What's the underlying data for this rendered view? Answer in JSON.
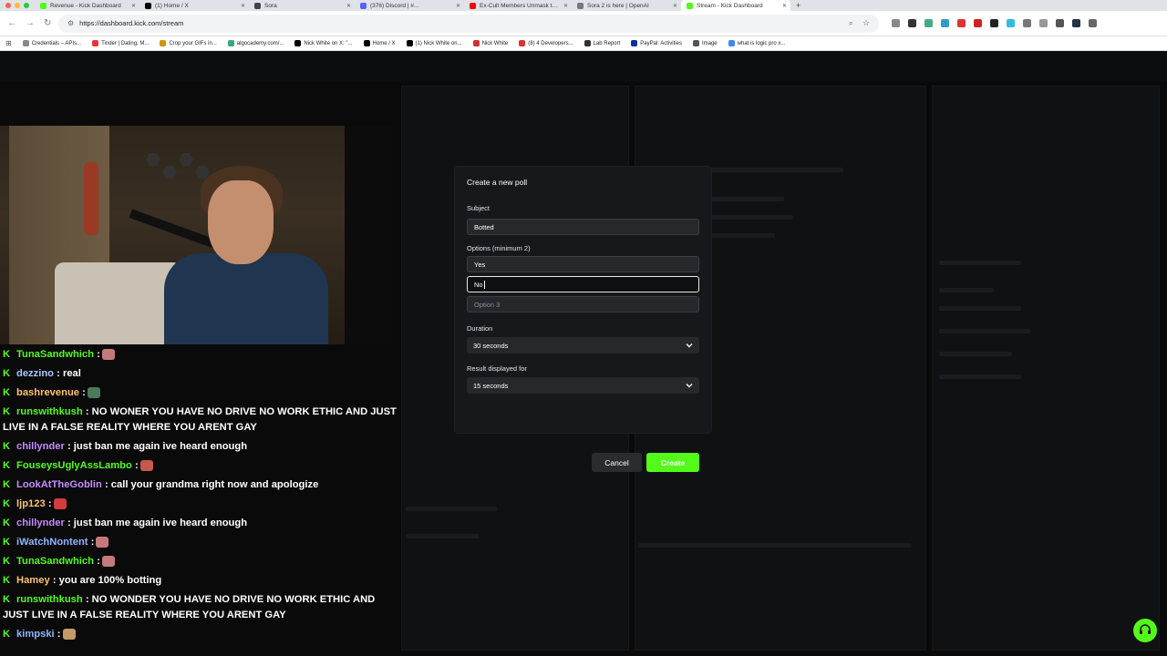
{
  "browser": {
    "tabs": [
      {
        "title": "Revenue - Kick Dashboard",
        "color": "#53fc18"
      },
      {
        "title": "(1) Home / X",
        "color": "#000000"
      },
      {
        "title": "Sora",
        "color": "#444444"
      },
      {
        "title": "(376) Discord | #...",
        "color": "#5865f2"
      },
      {
        "title": "Ex-Cult Members Unmask th...",
        "color": "#ff0000"
      },
      {
        "title": "Sora 2 is here | OpenAI",
        "color": "#777777"
      },
      {
        "title": "Stream - Kick Dashboard",
        "color": "#53fc18",
        "active": true
      }
    ],
    "url": "https://dashboard.kick.com/stream",
    "bookmarks": [
      "Credentials – APIs...",
      "Tinder | Dating, M...",
      "Crop your GIFs in...",
      "algocademy.com/...",
      "Nick White on X: \"...",
      "Home / X",
      "(1) Nick White on...",
      "Nick White",
      "(8) 4 Developers...",
      "Lab Report",
      "PayPal: Activities",
      "Image",
      "what is logic pro x..."
    ]
  },
  "chat": [
    {
      "user": "TunaSandwhich",
      "color": "#53fc18",
      "text": ":",
      "emote": "#c47a7a"
    },
    {
      "user": "dezzino",
      "color": "#a8c8ff",
      "text": ": real"
    },
    {
      "user": "bashrevenue",
      "color": "#ffc26b",
      "text": ":",
      "emote": "#4a7a5a"
    },
    {
      "user": "runswithkush",
      "color": "#53fc18",
      "text": ": NO WONER YOU HAVE NO DRIVE NO WORK ETHIC AND JUST"
    },
    {
      "continuation": "LIVE IN A FALSE REALITY WHERE YOU ARENT GAY"
    },
    {
      "user": "chillynder",
      "color": "#c58cff",
      "text": ": just ban me again ive heard enough"
    },
    {
      "user": "FouseysUglyAssLambo",
      "color": "#53fc18",
      "text": ":",
      "emote": "#c45a4a"
    },
    {
      "user": "LookAtTheGoblin",
      "color": "#c58cff",
      "text": ": call your grandma right now and apologize"
    },
    {
      "user": "ljp123",
      "color": "#ffc26b",
      "text": ":",
      "emote": "#d43b3b"
    },
    {
      "user": "chillynder",
      "color": "#c58cff",
      "text": ": just ban me again ive heard enough"
    },
    {
      "user": "iWatchNontent",
      "color": "#8fb6ff",
      "text": ":",
      "emote": "#c47a7a"
    },
    {
      "user": "TunaSandwhich",
      "color": "#53fc18",
      "text": ":",
      "emote": "#c47a7a"
    },
    {
      "user": "Hamey",
      "color": "#ffc26b",
      "text": ": you are 100% botting"
    },
    {
      "user": "runswithkush",
      "color": "#53fc18",
      "text": ": NO WONDER YOU HAVE NO DRIVE NO WORK ETHIC AND"
    },
    {
      "continuation": "JUST LIVE IN A FALSE REALITY WHERE YOU ARENT GAY"
    },
    {
      "user": "kimpski",
      "color": "#8fb6ff",
      "text": ":",
      "emote": "#c49a6a"
    }
  ],
  "poll": {
    "title": "Create a new poll",
    "subject_label": "Subject",
    "subject_value": "Botted",
    "options_label": "Options (minimum 2)",
    "option1": "Yes",
    "option2": "No",
    "option3_placeholder": "Option 3",
    "duration_label": "Duration",
    "duration_value": "30 seconds",
    "result_label": "Result displayed for",
    "result_value": "15 seconds",
    "cancel": "Cancel",
    "create": "Create"
  },
  "colors": {
    "accent": "#53fc18"
  }
}
